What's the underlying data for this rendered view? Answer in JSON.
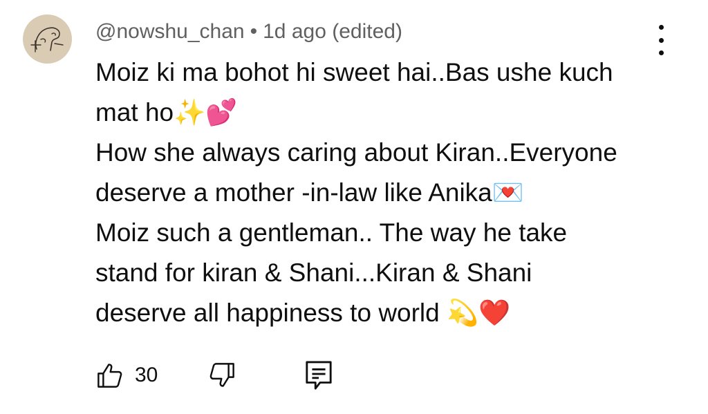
{
  "comment": {
    "author": "@nowshu_chan",
    "separator": "•",
    "timestamp": "1d ago (edited)",
    "lines": [
      "Moiz ki ma bohot hi sweet hai..Bas ushe kuch",
      "mat ho✨💕",
      "How she always caring about Kiran..Everyone",
      "deserve a mother -in-law like Anika💌",
      "Moiz such a gentleman.. The way he take",
      "stand for kiran & Shani...Kiran & Shani",
      "deserve all happiness to world 💫❤️"
    ]
  },
  "actions": {
    "like_count": "30",
    "like_icon": "thumbs-up-icon",
    "dislike_icon": "thumbs-down-icon",
    "reply_icon": "reply-comment-icon",
    "more_icon": "vertical-ellipsis-icon"
  },
  "colors": {
    "text": "#0f0f0f",
    "meta": "#606060",
    "avatar_bg": "#d9cbb4"
  }
}
